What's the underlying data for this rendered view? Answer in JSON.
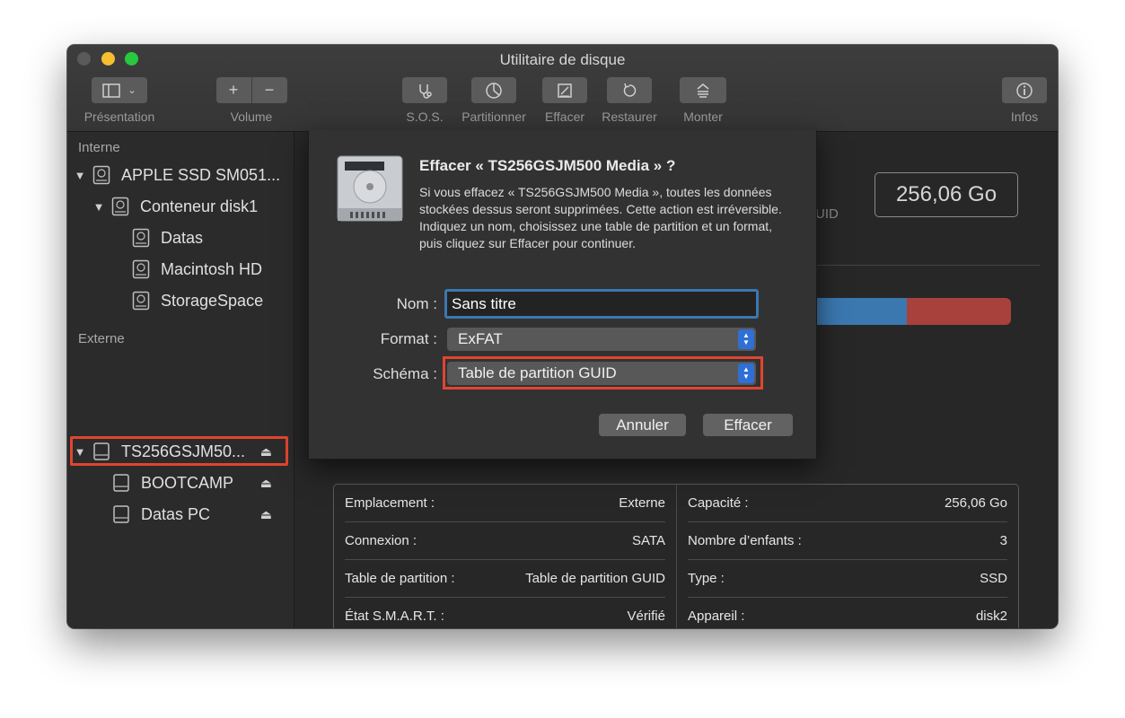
{
  "window": {
    "title": "Utilitaire de disque"
  },
  "toolbar": {
    "presentation": "Présentation",
    "volume": "Volume",
    "sos": "S.O.S.",
    "partition": "Partitionner",
    "erase": "Effacer",
    "restore": "Restaurer",
    "mount": "Monter",
    "info": "Infos"
  },
  "sidebar": {
    "internal_title": "Interne",
    "external_title": "Externe",
    "internal": [
      {
        "label": "APPLE SSD SM051...",
        "level": 0
      },
      {
        "label": "Conteneur disk1",
        "level": 1
      },
      {
        "label": "Datas",
        "level": 2
      },
      {
        "label": "Macintosh HD",
        "level": 2
      },
      {
        "label": "StorageSpace",
        "level": 2
      }
    ],
    "external": [
      {
        "label": "TS256GSJM50...",
        "level": 0,
        "selected": true
      },
      {
        "label": "BOOTCAMP",
        "level": 1
      },
      {
        "label": "Datas PC",
        "level": 1
      }
    ]
  },
  "main": {
    "capacity_badge": "256,06 Go",
    "guid_fragment": "UID",
    "usage": {
      "blue_fraction": 0.47,
      "red_fraction": 0.53
    },
    "info": {
      "location_label": "Emplacement :",
      "location_value": "Externe",
      "connection_label": "Connexion :",
      "connection_value": "SATA",
      "partition_map_label": "Table de partition :",
      "partition_map_value": "Table de partition GUID",
      "smart_label": "État S.M.A.R.T. :",
      "smart_value": "Vérifié",
      "capacity_label": "Capacité :",
      "capacity_value": "256,06 Go",
      "children_label": "Nombre d’enfants :",
      "children_value": "3",
      "type_label": "Type :",
      "type_value": "SSD",
      "device_label": "Appareil :",
      "device_value": "disk2"
    }
  },
  "dialog": {
    "title": "Effacer « TS256GSJM500 Media » ?",
    "message": "Si vous effacez « TS256GSJM500 Media », toutes les données stockées dessus seront supprimées. Cette action est irréversible. Indiquez un nom, choisissez une table de partition et un format, puis cliquez sur Effacer pour continuer.",
    "name_label": "Nom :",
    "name_value": "Sans titre",
    "format_label": "Format :",
    "format_value": "ExFAT",
    "scheme_label": "Schéma :",
    "scheme_value": "Table de partition GUID",
    "cancel": "Annuler",
    "erase": "Effacer"
  },
  "colors": {
    "accent": "#3b78b0",
    "highlight": "#e0452f",
    "select_arrows": "#2f6fd6"
  }
}
